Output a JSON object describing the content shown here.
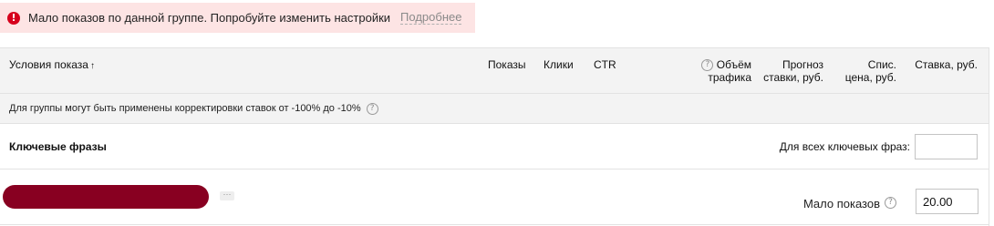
{
  "warning": {
    "text": "Мало показов по данной группе. Попробуйте изменить настройки",
    "link": "Подробнее",
    "icon": "exclamation-icon",
    "color": "#d6001c"
  },
  "table": {
    "columns": {
      "conditions": "Условия показа",
      "sort_arrow": "↑",
      "impressions": "Показы",
      "clicks": "Клики",
      "ctr": "CTR",
      "traffic_line1": "Объём",
      "traffic_line2": "трафика",
      "forecast_line1": "Прогноз",
      "forecast_line2": "ставки, руб.",
      "charge_line1": "Спис.",
      "charge_line2": "цена, руб.",
      "bid": "Ставка, руб."
    },
    "info_text": "Для группы могут быть применены корректировки ставок от -100% до -10%",
    "keywords": {
      "title": "Ключевые фразы",
      "all_label": "Для всех ключевых фраз:",
      "all_value": ""
    },
    "phrase_row": {
      "status": "Мало показов",
      "bid_value": "20.00",
      "more": "···"
    }
  },
  "help_glyph": "?",
  "warn_glyph": "!"
}
